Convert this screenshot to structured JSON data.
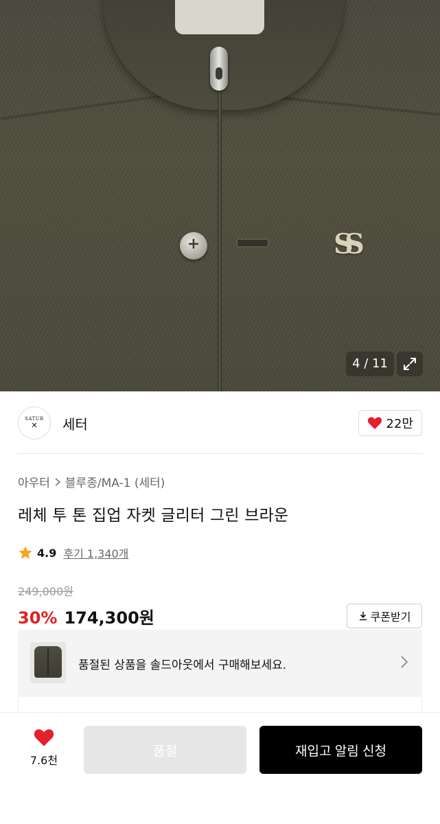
{
  "gallery": {
    "current": "4 / 11",
    "expand_icon": "expand-icon"
  },
  "brand": {
    "logo_text": "SATUR",
    "name": "세터",
    "likes": "22만"
  },
  "product": {
    "breadcrumb": [
      "아우터",
      "블루종/MA-1 (세터)"
    ],
    "title": "레체 투 톤 집업 자켓 글리터 그린 브라운",
    "rating": "4.9",
    "reviews": "후기 1,340개",
    "original_price": "249,000원",
    "discount": "30%",
    "price": "174,300원",
    "coupon_label": "쿠폰받기"
  },
  "soldout_banner": {
    "text": "품절된 상품을 솔드아웃에서 구매해보세요."
  },
  "bottom_bar": {
    "wish_count": "7.6천",
    "soldout_label": "품절",
    "restock_label": "재입고 알림 신청"
  },
  "colors": {
    "accent_red": "#e02020",
    "heart": "#e5202e",
    "primary_button": "#000000",
    "disabled_button": "#e6e6e6"
  }
}
